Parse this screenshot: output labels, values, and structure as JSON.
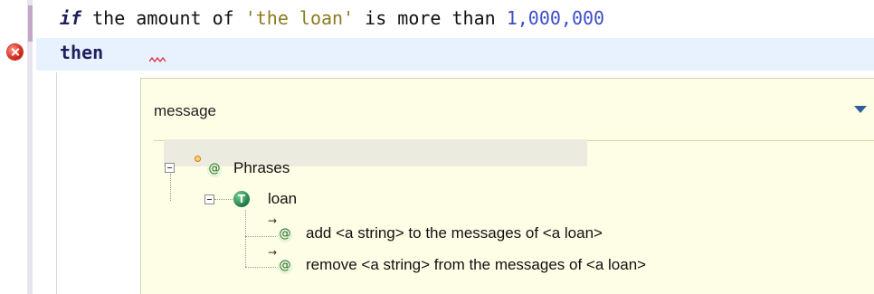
{
  "editor": {
    "line1": {
      "kw_if": "if",
      "text_a": " the amount of ",
      "str": "'the loan'",
      "text_b": " is more than ",
      "num": "1,000,000"
    },
    "line2": {
      "kw_then": "then"
    },
    "error_marker": "error-icon"
  },
  "popup": {
    "header": "message",
    "tree": {
      "root_label": "Phrases",
      "type_label": "loan",
      "type_icon_letter": "T",
      "items": [
        "add <a string> to the messages of <a loan>",
        "remove <a string> from the messages of <a loan>"
      ]
    }
  },
  "icons": {
    "at_char": "@",
    "arrow": "→"
  },
  "colors": {
    "keyword": "#1f1f5f",
    "string": "#8d7a22",
    "number": "#3c4dc6",
    "popup_bg": "#fefee6",
    "current_line": "#e8f2fe"
  }
}
